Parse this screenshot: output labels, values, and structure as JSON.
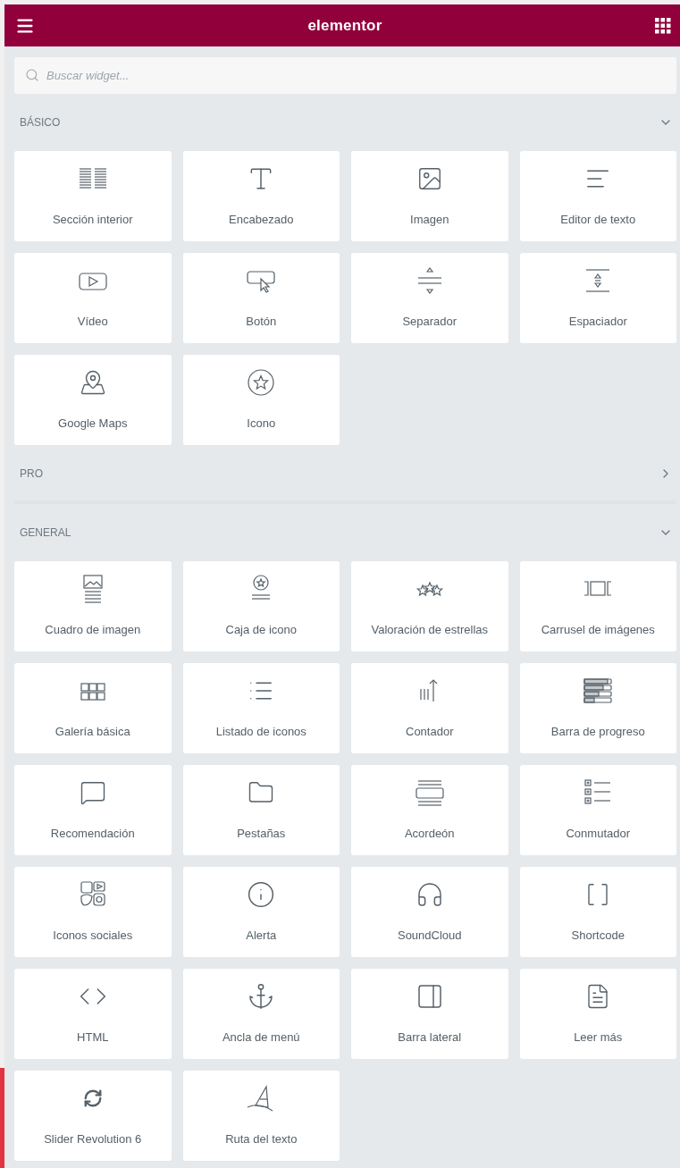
{
  "header": {
    "logo": "elementor"
  },
  "search": {
    "placeholder": "Buscar widget..."
  },
  "sections": [
    {
      "title": "BÁSICO",
      "expanded": true,
      "widgets": [
        "Sección interior",
        "Encabezado",
        "Imagen",
        "Editor de texto",
        "Vídeo",
        "Botón",
        "Separador",
        "Espaciador",
        "Google Maps",
        "Icono"
      ]
    },
    {
      "title": "PRO",
      "expanded": false
    },
    {
      "title": "GENERAL",
      "expanded": true,
      "widgets": [
        "Cuadro de imagen",
        "Caja de icono",
        "Valoración de estrellas",
        "Carrusel de imágenes",
        "Galería básica",
        "Listado de iconos",
        "Contador",
        "Barra de progreso",
        "Recomendación",
        "Pestañas",
        "Acordeón",
        "Conmutador",
        "Iconos sociales",
        "Alerta",
        "SoundCloud",
        "Shortcode",
        "HTML",
        "Ancla de menú",
        "Barra lateral",
        "Leer más",
        "Slider Revolution 6",
        "Ruta del texto"
      ]
    }
  ]
}
